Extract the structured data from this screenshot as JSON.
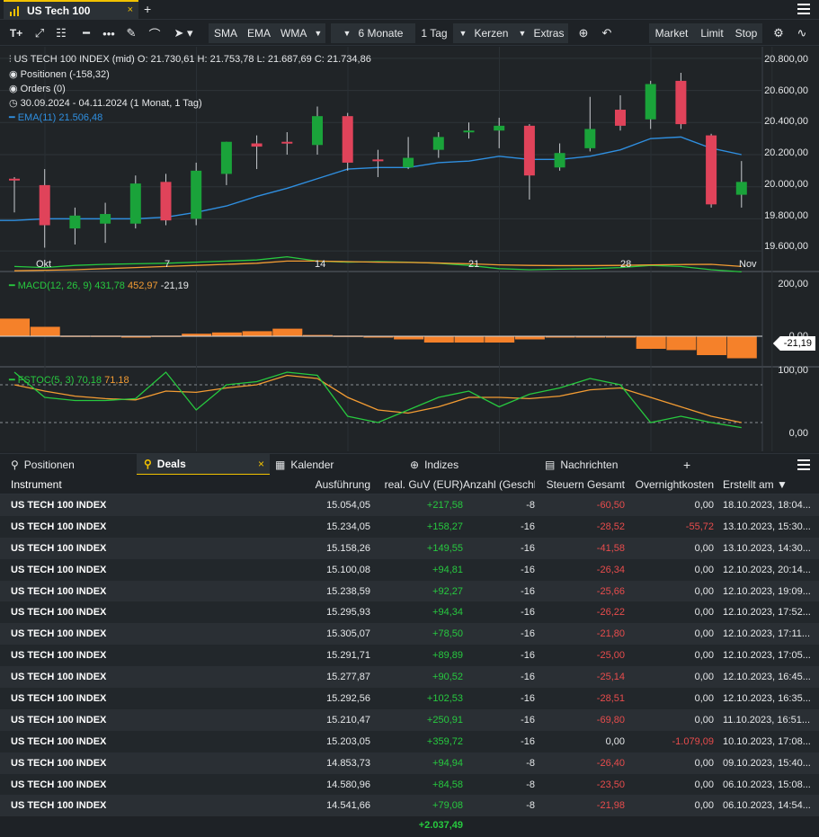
{
  "window": {
    "tab_title": "US Tech 100",
    "tab_close": "×",
    "add_tab": "+"
  },
  "toolbar": {
    "text_tool": "T+",
    "indicators": [
      "SMA",
      "EMA",
      "WMA"
    ],
    "period": "6 Monate",
    "interval": "1 Tag",
    "chart_type": "Kerzen",
    "extras": "Extras",
    "orders": [
      "Market",
      "Limit",
      "Stop"
    ]
  },
  "legend": {
    "header": "US TECH 100 INDEX (mid)  O: 21.730,61  H: 21.753,78  L: 21.687,69  C: 21.734,86",
    "positions": "Positionen (-158,32)",
    "orders": "Orders (0)",
    "range": "30.09.2024 - 04.11.2024   (1 Monat, 1 Tag)",
    "ema_name": "EMA(11)",
    "ema_value": "21.506,48",
    "macd_name": "MACD(12, 26, 9)",
    "macd_v1": "431,78",
    "macd_v2": "452,97",
    "macd_v3": "-21,19",
    "stoch_name": "FSTOC(5, 3)",
    "stoch_v1": "70,18",
    "stoch_v2": "71,18",
    "macd_marker": "-21,19"
  },
  "chart_data": {
    "type": "candlestick",
    "price_axis": [
      "20.800,00",
      "20.600,00",
      "20.400,00",
      "20.200,00",
      "20.000,00",
      "19.800,00",
      "19.600,00"
    ],
    "macd_axis": [
      "200,00",
      "0,00"
    ],
    "stoch_axis": [
      "100,00",
      "0,00"
    ],
    "x_labels": [
      "Okt",
      "7",
      "14",
      "21",
      "28",
      "Nov"
    ],
    "ylim": [
      19550,
      20850
    ],
    "candles": [
      {
        "o": 20050,
        "h": 20060,
        "l": 19840,
        "c": 20040
      },
      {
        "o": 20010,
        "h": 20110,
        "l": 19620,
        "c": 19760
      },
      {
        "o": 19740,
        "h": 19870,
        "l": 19640,
        "c": 19820
      },
      {
        "o": 19770,
        "h": 19900,
        "l": 19650,
        "c": 19830
      },
      {
        "o": 19770,
        "h": 20070,
        "l": 19740,
        "c": 20020
      },
      {
        "o": 20030,
        "h": 20080,
        "l": 19760,
        "c": 19790
      },
      {
        "o": 19800,
        "h": 20150,
        "l": 19760,
        "c": 20100
      },
      {
        "o": 20080,
        "h": 20280,
        "l": 20010,
        "c": 20280
      },
      {
        "o": 20270,
        "h": 20320,
        "l": 20110,
        "c": 20250
      },
      {
        "o": 20280,
        "h": 20340,
        "l": 20200,
        "c": 20270
      },
      {
        "o": 20260,
        "h": 20500,
        "l": 20200,
        "c": 20440
      },
      {
        "o": 20440,
        "h": 20460,
        "l": 20100,
        "c": 20150
      },
      {
        "o": 20170,
        "h": 20230,
        "l": 20060,
        "c": 20160
      },
      {
        "o": 20120,
        "h": 20310,
        "l": 20110,
        "c": 20180
      },
      {
        "o": 20230,
        "h": 20340,
        "l": 20180,
        "c": 20310
      },
      {
        "o": 20350,
        "h": 20400,
        "l": 20300,
        "c": 20350
      },
      {
        "o": 20350,
        "h": 20430,
        "l": 20240,
        "c": 20380
      },
      {
        "o": 20380,
        "h": 20390,
        "l": 19920,
        "c": 20070
      },
      {
        "o": 20120,
        "h": 20270,
        "l": 20100,
        "c": 20210
      },
      {
        "o": 20240,
        "h": 20560,
        "l": 20220,
        "c": 20360
      },
      {
        "o": 20480,
        "h": 20570,
        "l": 20350,
        "c": 20380
      },
      {
        "o": 20420,
        "h": 20660,
        "l": 20360,
        "c": 20640
      },
      {
        "o": 20660,
        "h": 20710,
        "l": 20360,
        "c": 20390
      },
      {
        "o": 20320,
        "h": 20330,
        "l": 19870,
        "c": 19890
      },
      {
        "o": 19950,
        "h": 20160,
        "l": 19870,
        "c": 20030
      }
    ],
    "ema": [
      19790,
      19800,
      19800,
      19800,
      19800,
      19810,
      19840,
      19880,
      19940,
      19990,
      20050,
      20110,
      20120,
      20120,
      20150,
      20160,
      20190,
      20170,
      20170,
      20190,
      20230,
      20300,
      20310,
      20240,
      20200
    ],
    "macd_hist": [
      28,
      15,
      1,
      1,
      -2,
      1,
      4,
      6,
      8,
      12,
      2,
      1,
      0,
      -5,
      -10,
      -10,
      -10,
      -5,
      -2,
      -1,
      -2,
      -20,
      -22,
      -30,
      -35
    ],
    "macd_line": [
      430,
      420,
      440,
      450,
      455,
      460,
      470,
      480,
      490,
      520,
      480,
      470,
      475,
      470,
      460,
      440,
      410,
      400,
      405,
      410,
      420,
      440,
      430,
      400,
      380
    ],
    "macd_signal": [
      390,
      395,
      400,
      410,
      420,
      430,
      440,
      450,
      460,
      480,
      480,
      475,
      470,
      468,
      462,
      455,
      445,
      440,
      438,
      438,
      440,
      445,
      448,
      450,
      430
    ],
    "stoch_k": [
      100,
      60,
      55,
      55,
      58,
      100,
      40,
      80,
      85,
      100,
      95,
      30,
      20,
      40,
      60,
      70,
      45,
      65,
      75,
      90,
      80,
      20,
      30,
      20,
      12
    ],
    "stoch_d": [
      80,
      70,
      62,
      58,
      56,
      70,
      68,
      75,
      80,
      95,
      90,
      60,
      40,
      35,
      45,
      60,
      60,
      58,
      62,
      72,
      75,
      60,
      45,
      30,
      20
    ]
  },
  "bottom_tabs": {
    "positions": "Positionen",
    "deals": "Deals",
    "calendar": "Kalender",
    "indices": "Indizes",
    "news": "Nachrichten",
    "add": "+",
    "close": "×"
  },
  "table": {
    "headers": {
      "instrument": "Instrument",
      "execution": "Ausführung",
      "pnl": "real. GuV (EUR)",
      "qty": "Anzahl (Geschl",
      "tax": "Steuern Gesamt",
      "overnight": "Overnightkosten",
      "created": "Erstellt am ▼"
    },
    "rows": [
      {
        "inst": "US TECH 100 INDEX",
        "exec": "15.054,05",
        "pnl": "+217,58",
        "qty": "-8",
        "tax": "-60,50",
        "ov": "0,00",
        "date": "18.10.2023, 18:04..."
      },
      {
        "inst": "US TECH 100 INDEX",
        "exec": "15.234,05",
        "pnl": "+158,27",
        "qty": "-16",
        "tax": "-28,52",
        "ov": "-55,72",
        "date": "13.10.2023, 15:30..."
      },
      {
        "inst": "US TECH 100 INDEX",
        "exec": "15.158,26",
        "pnl": "+149,55",
        "qty": "-16",
        "tax": "-41,58",
        "ov": "0,00",
        "date": "13.10.2023, 14:30..."
      },
      {
        "inst": "US TECH 100 INDEX",
        "exec": "15.100,08",
        "pnl": "+94,81",
        "qty": "-16",
        "tax": "-26,34",
        "ov": "0,00",
        "date": "12.10.2023, 20:14..."
      },
      {
        "inst": "US TECH 100 INDEX",
        "exec": "15.238,59",
        "pnl": "+92,27",
        "qty": "-16",
        "tax": "-25,66",
        "ov": "0,00",
        "date": "12.10.2023, 19:09..."
      },
      {
        "inst": "US TECH 100 INDEX",
        "exec": "15.295,93",
        "pnl": "+94,34",
        "qty": "-16",
        "tax": "-26,22",
        "ov": "0,00",
        "date": "12.10.2023, 17:52..."
      },
      {
        "inst": "US TECH 100 INDEX",
        "exec": "15.305,07",
        "pnl": "+78,50",
        "qty": "-16",
        "tax": "-21,80",
        "ov": "0,00",
        "date": "12.10.2023, 17:11..."
      },
      {
        "inst": "US TECH 100 INDEX",
        "exec": "15.291,71",
        "pnl": "+89,89",
        "qty": "-16",
        "tax": "-25,00",
        "ov": "0,00",
        "date": "12.10.2023, 17:05..."
      },
      {
        "inst": "US TECH 100 INDEX",
        "exec": "15.277,87",
        "pnl": "+90,52",
        "qty": "-16",
        "tax": "-25,14",
        "ov": "0,00",
        "date": "12.10.2023, 16:45..."
      },
      {
        "inst": "US TECH 100 INDEX",
        "exec": "15.292,56",
        "pnl": "+102,53",
        "qty": "-16",
        "tax": "-28,51",
        "ov": "0,00",
        "date": "12.10.2023, 16:35..."
      },
      {
        "inst": "US TECH 100 INDEX",
        "exec": "15.210,47",
        "pnl": "+250,91",
        "qty": "-16",
        "tax": "-69,80",
        "ov": "0,00",
        "date": "11.10.2023, 16:51..."
      },
      {
        "inst": "US TECH 100 INDEX",
        "exec": "15.203,05",
        "pnl": "+359,72",
        "qty": "-16",
        "tax": "0,00",
        "ov": "-1.079,09",
        "date": "10.10.2023, 17:08..."
      },
      {
        "inst": "US TECH 100 INDEX",
        "exec": "14.853,73",
        "pnl": "+94,94",
        "qty": "-8",
        "tax": "-26,40",
        "ov": "0,00",
        "date": "09.10.2023, 15:40..."
      },
      {
        "inst": "US TECH 100 INDEX",
        "exec": "14.580,96",
        "pnl": "+84,58",
        "qty": "-8",
        "tax": "-23,50",
        "ov": "0,00",
        "date": "06.10.2023, 15:08..."
      },
      {
        "inst": "US TECH 100 INDEX",
        "exec": "14.541,66",
        "pnl": "+79,08",
        "qty": "-8",
        "tax": "-21,98",
        "ov": "0,00",
        "date": "06.10.2023, 14:54..."
      }
    ],
    "total_pnl": "+2.037,49"
  },
  "colors": {
    "up": "#1aa33a",
    "down": "#e0435a",
    "ema": "#2f8fe0",
    "macd_bar": "#f5812a",
    "accent": "#f2c200"
  }
}
